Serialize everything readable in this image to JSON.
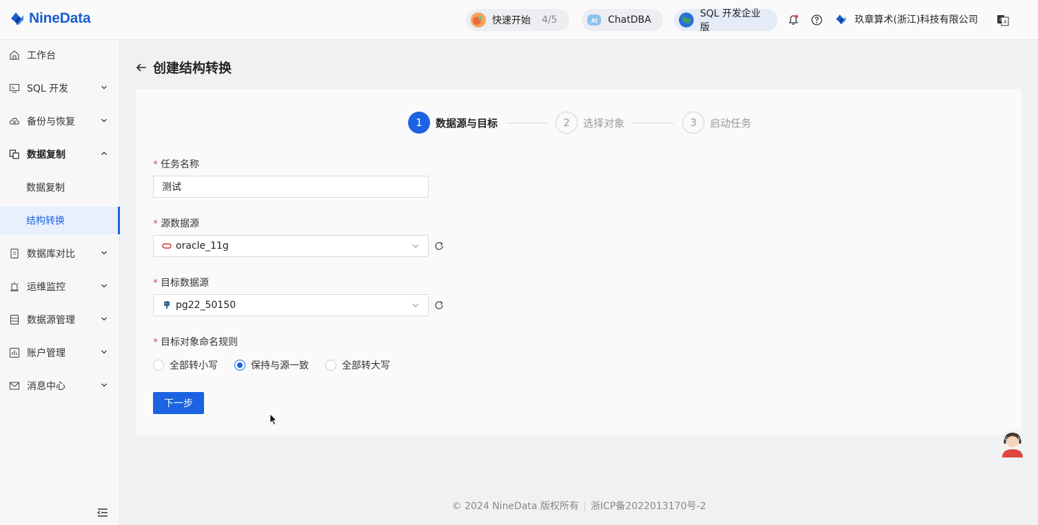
{
  "header": {
    "logo_text": "NineData",
    "quick_start": {
      "label": "快速开始",
      "progress": "4/5"
    },
    "chatdba": {
      "label": "ChatDBA"
    },
    "sql_edition": {
      "label": "SQL 开发企业版"
    },
    "org_name": "玖章算术(浙江)科技有限公司"
  },
  "sidebar": {
    "items": [
      {
        "label": "工作台",
        "icon": "home-icon"
      },
      {
        "label": "SQL 开发",
        "icon": "monitor-icon"
      },
      {
        "label": "备份与恢复",
        "icon": "cloud-icon"
      },
      {
        "label": "数据复制",
        "icon": "copy-icon"
      },
      {
        "label": "数据库对比",
        "icon": "compare-icon"
      },
      {
        "label": "运维监控",
        "icon": "alarm-icon"
      },
      {
        "label": "数据源管理",
        "icon": "database-icon"
      },
      {
        "label": "账户管理",
        "icon": "account-icon"
      },
      {
        "label": "消息中心",
        "icon": "mail-icon"
      }
    ],
    "sub_items": [
      {
        "label": "数据复制"
      },
      {
        "label": "结构转换"
      }
    ]
  },
  "page": {
    "title": "创建结构转换"
  },
  "steps": [
    {
      "num": "1",
      "label": "数据源与目标"
    },
    {
      "num": "2",
      "label": "选择对象"
    },
    {
      "num": "3",
      "label": "启动任务"
    }
  ],
  "form": {
    "required_mark": "*",
    "task_name": {
      "label": "任务名称",
      "value": "测试"
    },
    "source": {
      "label": "源数据源",
      "value": "oracle_11g"
    },
    "target": {
      "label": "目标数据源",
      "value": "pg22_50150"
    },
    "naming_rule": {
      "label": "目标对象命名规则",
      "options": [
        "全部转小写",
        "保持与源一致",
        "全部转大写"
      ],
      "selected": "保持与源一致"
    },
    "next_button": "下一步"
  },
  "footer": {
    "copyright": "© 2024 NineData 版权所有",
    "icp": "浙ICP备2022013170号-2"
  },
  "colors": {
    "accent": "#1b63e0",
    "required": "#e5484d"
  }
}
